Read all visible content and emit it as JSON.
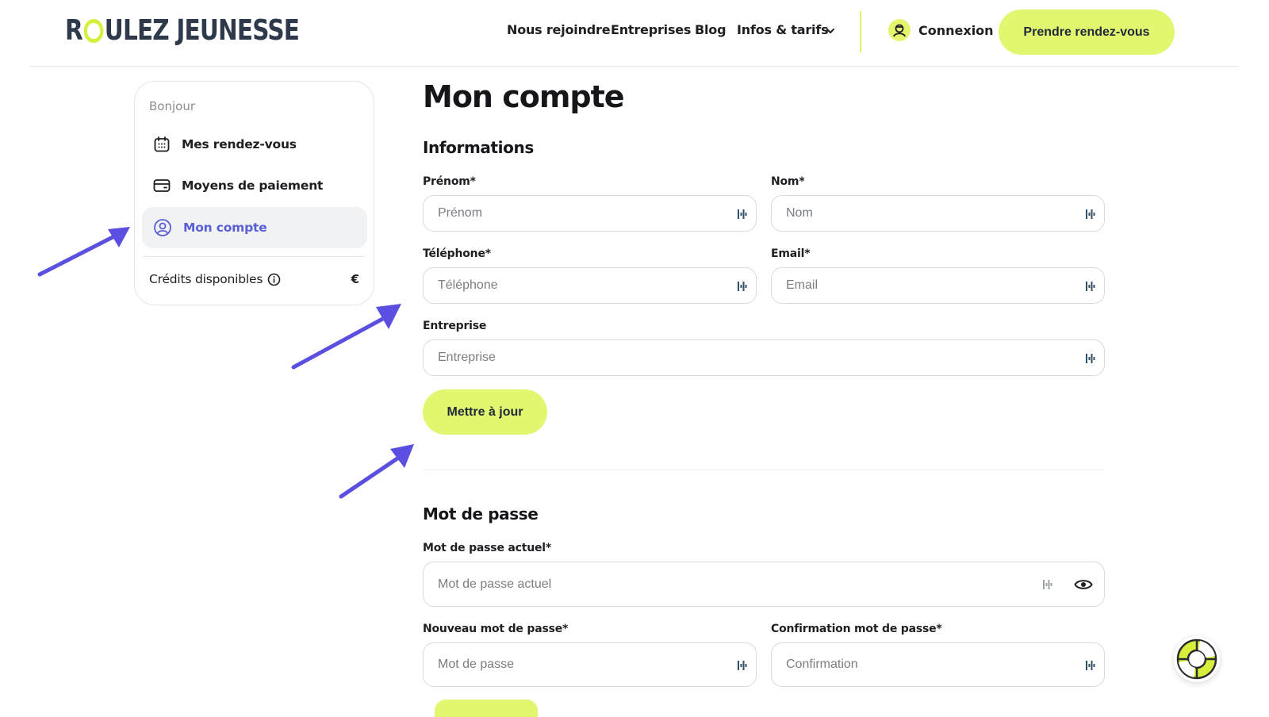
{
  "brand": {
    "logo_pre": "R",
    "logo_post": "ULEZ JEUNESSE",
    "accent": "#e3f66f",
    "ring": "#d8ee3c",
    "active_color": "#5a5fd6",
    "arrow_color": "#5a4fe0"
  },
  "nav": {
    "items": [
      "Nous rejoindre",
      "Entreprises",
      "Blog",
      "Infos & tarifs"
    ],
    "login_label": "Connexion",
    "cta_label": "Prendre rendez-vous"
  },
  "sidebar": {
    "greeting": "Bonjour",
    "items": [
      {
        "label": "Mes rendez-vous",
        "icon": "calendar-icon"
      },
      {
        "label": "Moyens de paiement",
        "icon": "credit-card-icon"
      },
      {
        "label": "Mon compte",
        "icon": "user-circle-icon",
        "active": true
      }
    ],
    "credits_label": "Crédits disponibles",
    "credits_value": "€"
  },
  "main": {
    "title": "Mon compte",
    "info_section": {
      "title": "Informations",
      "fields": {
        "firstname": {
          "label": "Prénom*",
          "placeholder": "Prénom"
        },
        "lastname": {
          "label": "Nom*",
          "placeholder": "Nom"
        },
        "phone": {
          "label": "Téléphone*",
          "placeholder": "Téléphone"
        },
        "email": {
          "label": "Email*",
          "placeholder": "Email"
        },
        "company": {
          "label": "Entreprise",
          "placeholder": "Entreprise"
        }
      },
      "submit_label": "Mettre à jour"
    },
    "password_section": {
      "title": "Mot de passe",
      "fields": {
        "current": {
          "label": "Mot de passe actuel*",
          "placeholder": "Mot de passe actuel"
        },
        "new": {
          "label": "Nouveau mot de passe*",
          "placeholder": "Mot de passe"
        },
        "confirm": {
          "label": "Confirmation mot de passe*",
          "placeholder": "Confirmation"
        }
      }
    }
  }
}
